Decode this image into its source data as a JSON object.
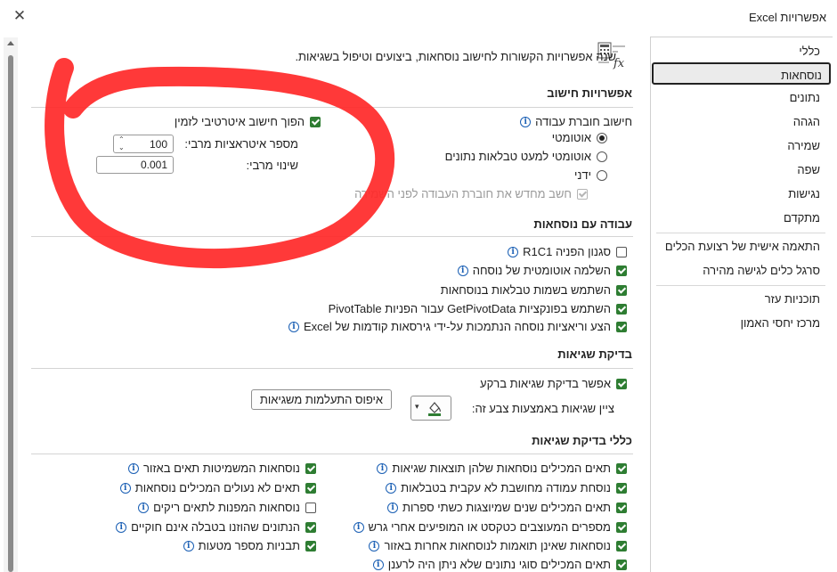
{
  "window": {
    "title": "אפשרויות Excel",
    "close_glyph": "✕"
  },
  "sidebar": {
    "items": [
      "כללי",
      "נוסחאות",
      "נתונים",
      "הגהה",
      "שמירה",
      "שפה",
      "נגישות",
      "מתקדם",
      "התאמה אישית של רצועת הכלים",
      "סרגל כלים לגישה מהירה",
      "תוכניות עזר",
      "מרכז יחסי האמון"
    ],
    "selected_index": 1
  },
  "header": {
    "description": "שנה אפשרויות הקשורות לחישוב נוסחאות, ביצועים וטיפול בשגיאות."
  },
  "calc": {
    "title": "אפשרויות חישוב",
    "workbook_label": "חישוב חוברת עבודה",
    "radio_auto": "אוטומטי",
    "radio_auto_except": "אוטומטי למעט טבלאות נתונים",
    "radio_manual": "ידני",
    "recalc_before_save": "חשב מחדש את חוברת העבודה לפני השמירה",
    "iterative": "הפוך חישוב איטרטיבי לזמין",
    "max_iter_label": "מספר איטראציות מרבי:",
    "max_iter_value": "100",
    "max_change_label": "שינוי מרבי:",
    "max_change_value": "0.001"
  },
  "formulas": {
    "title": "עבודה עם נוסחאות",
    "items": [
      "סגנון הפניה R1C1",
      "השלמה אוטומטית של נוסחה",
      "השתמש בשמות טבלאות בנוסחאות",
      "השתמש בפונקציות GetPivotData עבור הפניות PivotTable",
      "הצע וריאציות נוסחה הנתמכות על-ידי גירסאות קודמות של Excel"
    ]
  },
  "error_check": {
    "title": "בדיקת שגיאות",
    "enable": "אפשר בדיקת שגיאות ברקע",
    "color_label": "ציין שגיאות באמצעות צבע זה:",
    "reset_button": "איפוס התעלמות משגיאות",
    "color_value": "#2e7d32"
  },
  "rules": {
    "title": "כללי בדיקת שגיאות",
    "right": [
      "תאים המכילים נוסחאות שלהן תוצאות שגיאות",
      "נוסחת עמודה מחושבת לא עקבית בטבלאות",
      "תאים המכילים שנים שמיוצגות כשתי ספרות",
      "מספרים המעוצבים כטקסט או המופיעים אחרי גרש",
      "נוסחאות שאינן תואמות לנוסחאות אחרות באזור",
      "תאים המכילים סוגי נתונים שלא ניתן היה לרענן"
    ],
    "left": [
      "נוסחאות המשמיטות תאים באזור",
      "תאים לא נעולים המכילים נוסחאות",
      "נוסחאות המפנות לתאים ריקים",
      "הנתונים שהוזנו בטבלה אינם חוקיים",
      "תבניות מספר מטעות"
    ]
  },
  "colors": {
    "check_green": "#2e7d32",
    "info_blue": "#1a5fb4",
    "annotation_red": "#ff2a2a"
  }
}
